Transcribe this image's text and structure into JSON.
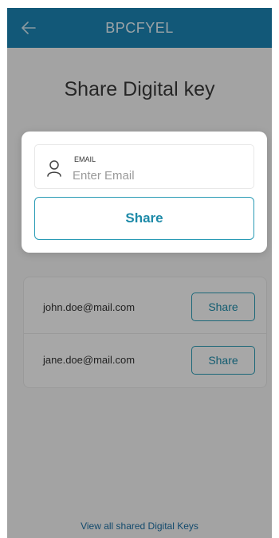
{
  "appbar": {
    "title": "BPCFYEL",
    "back_icon": "arrow-left-icon"
  },
  "page": {
    "title": "Share Digital key"
  },
  "modal": {
    "email_label": "EMAIL",
    "email_placeholder": "Enter Email",
    "email_value": "",
    "email_icon": "person-icon",
    "share_label": "Share"
  },
  "shared_list": [
    {
      "email": "john.doe@mail.com",
      "button_label": "Share"
    },
    {
      "email": "jane.doe@mail.com",
      "button_label": "Share"
    }
  ],
  "footer": {
    "link_label": "View all shared Digital Keys"
  },
  "colors": {
    "appbar": "#1b84b3",
    "accent": "#1d8aa8",
    "link": "#1d6fa3"
  }
}
